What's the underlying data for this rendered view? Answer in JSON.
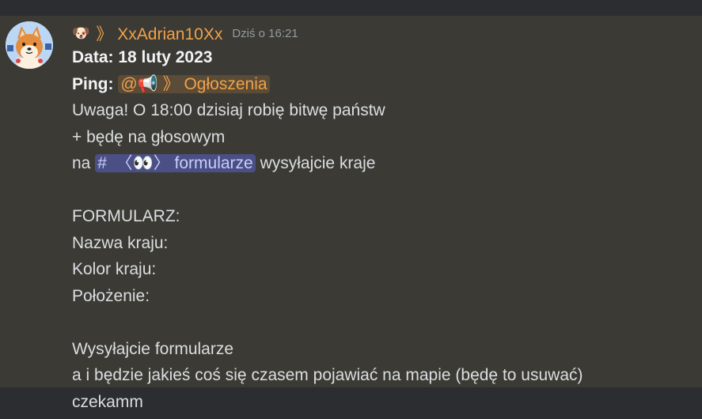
{
  "message": {
    "author": {
      "emoji": "🐶",
      "separator": "》",
      "name": "XxAdrian10Xx"
    },
    "timestamp": "Dziś o 16:21",
    "data_label": "Data:",
    "data_value": "18 luty 2023",
    "ping_label": "Ping:",
    "ping_role": "@📢 》 Ogłoszenia",
    "line_1": "Uwaga! O 18:00 dzisiaj robię bitwę państw",
    "line_2": "+ będę na głosowym",
    "line_3_prefix": "na",
    "channel_mention": "#  〈👀〉 formularze",
    "line_3_suffix": "wysyłajcie kraje",
    "form_title": "FORMULARZ:",
    "form_name": "Nazwa kraju:",
    "form_color": "Kolor kraju:",
    "form_location": "Położenie:",
    "line_send": "Wysyłajcie formularze",
    "line_map": "a i będzie jakieś coś się czasem pojawiać na mapie (będę to usuwać)"
  },
  "next_message": {
    "text": "czekamm"
  },
  "colors": {
    "username": "#f0a24a",
    "message_bg": "#3b3a34",
    "app_bg": "#2b2d31",
    "channel_mention_bg": "#4a4f85"
  }
}
